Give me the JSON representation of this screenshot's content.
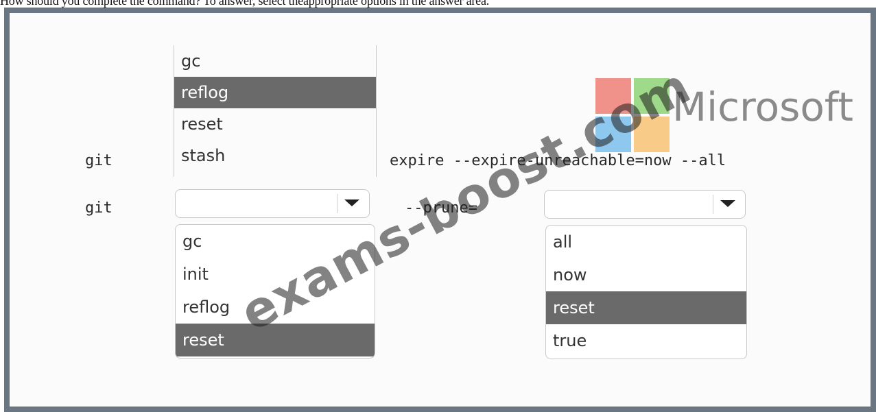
{
  "instruction": "How should you complete the command? To answer, select theappropriate options in the answer area.",
  "row1": {
    "prefix": "git",
    "options": [
      "gc",
      "reflog",
      "reset",
      "stash"
    ],
    "selected_index": 1,
    "suffix": "expire --expire-unreachable=now --all"
  },
  "row2": {
    "prefix": "git",
    "dropdown1": {
      "options": [
        "gc",
        "init",
        "reflog",
        "reset"
      ],
      "selected_index": 3
    },
    "middle": "--prune=",
    "dropdown2": {
      "options": [
        "all",
        "now",
        "reset",
        "true"
      ],
      "selected_index": 2
    }
  },
  "watermark": {
    "text": "exams-boost.com",
    "brand": "Microsoft"
  },
  "colors": {
    "frame": "#6b7683",
    "selected": "#6a6a6a",
    "ms_red": "#f0928a",
    "ms_green": "#9fd98a",
    "ms_blue": "#8ec8ef",
    "ms_yellow": "#f8cc88"
  }
}
